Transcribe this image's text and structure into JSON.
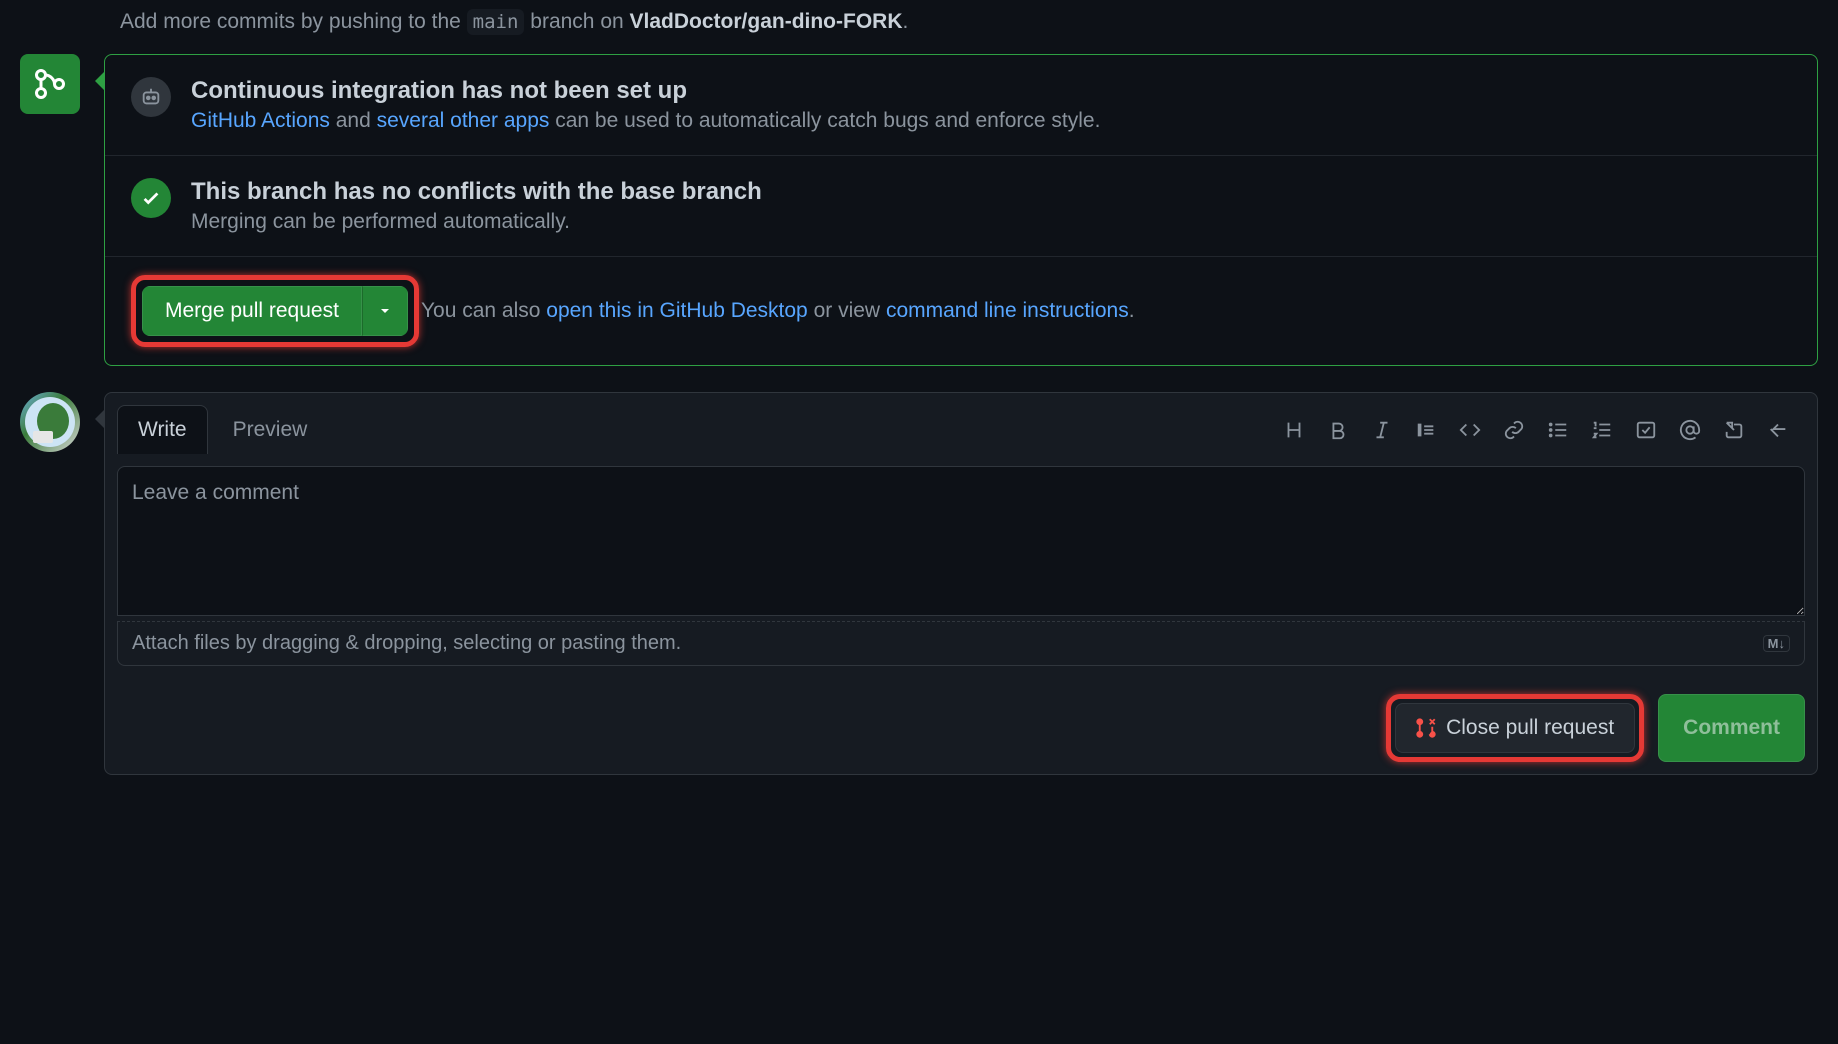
{
  "top_hint": {
    "prefix": "Add more commits by pushing to the ",
    "branch": "main",
    "mid": " branch on ",
    "repo": "VladDoctor/gan-dino-FORK",
    "suffix": "."
  },
  "ci": {
    "title": "Continuous integration has not been set up",
    "link_actions": "GitHub Actions",
    "mid1": " and ",
    "link_apps": "several other apps",
    "tail": " can be used to automatically catch bugs and enforce style."
  },
  "conflicts": {
    "title": "This branch has no conflicts with the base branch",
    "sub": "Merging can be performed automatically."
  },
  "merge": {
    "button": "Merge pull request",
    "hint_prefix": "You can also ",
    "open_desktop": "open this in GitHub Desktop",
    "hint_mid": " or view ",
    "cli": "command line instructions",
    "hint_suffix": "."
  },
  "tabs": {
    "write": "Write",
    "preview": "Preview"
  },
  "comment": {
    "placeholder": "Leave a comment",
    "attach": "Attach files by dragging & dropping, selecting or pasting them.",
    "md": "M↓"
  },
  "actions": {
    "close": "Close pull request",
    "comment": "Comment"
  }
}
